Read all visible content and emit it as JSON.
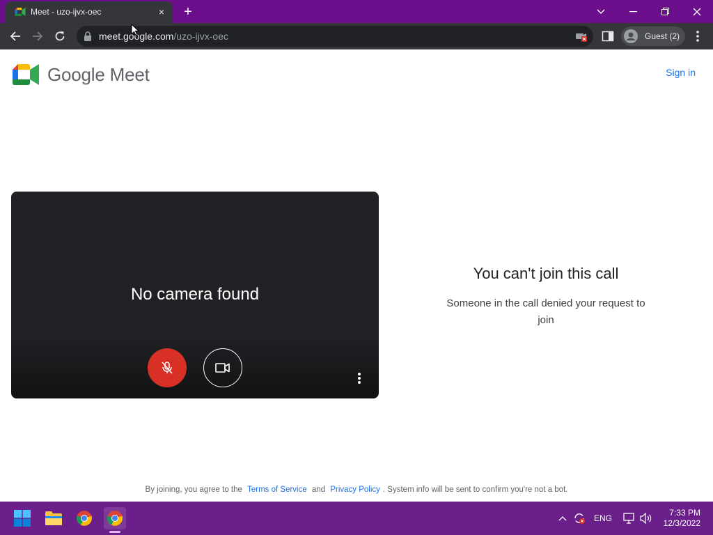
{
  "browser": {
    "tab_title": "Meet - uzo-ijvx-oec",
    "tab_close": "×",
    "new_tab": "+",
    "url_host": "meet.google.com",
    "url_path": "/uzo-ijvx-oec",
    "profile_label": "Guest (2)"
  },
  "page": {
    "brand": "Google Meet",
    "sign_in": "Sign in",
    "preview_status": "No camera found",
    "message_title": "You can't join this call",
    "message_body": "Someone in the call denied your request to join"
  },
  "footer": {
    "prefix": "By joining, you agree to the",
    "terms": "Terms of Service",
    "and": "and",
    "privacy": "Privacy Policy",
    "suffix": ". System info will be sent to confirm you're not a bot."
  },
  "taskbar": {
    "language": "ENG",
    "time": "7:33 PM",
    "date": "12/3/2022"
  },
  "colors": {
    "titlebar": "#6b0f8c",
    "taskbar": "#6b1f8a",
    "mic_off": "#d93025",
    "link": "#1a73e8"
  },
  "icons": [
    "meet-favicon-icon",
    "close-icon",
    "plus-icon",
    "chevron-down-icon",
    "minimize-icon",
    "restore-icon",
    "window-close-icon",
    "back-arrow-icon",
    "forward-arrow-icon",
    "reload-icon",
    "lock-icon",
    "camera-blocked-icon",
    "side-panel-icon",
    "guest-avatar-icon",
    "more-vert-icon",
    "microphone-off-icon",
    "video-camera-icon",
    "windows-start-icon",
    "file-explorer-icon",
    "chrome-icon",
    "chevron-up-icon",
    "sync-icon",
    "network-icon",
    "volume-icon"
  ]
}
